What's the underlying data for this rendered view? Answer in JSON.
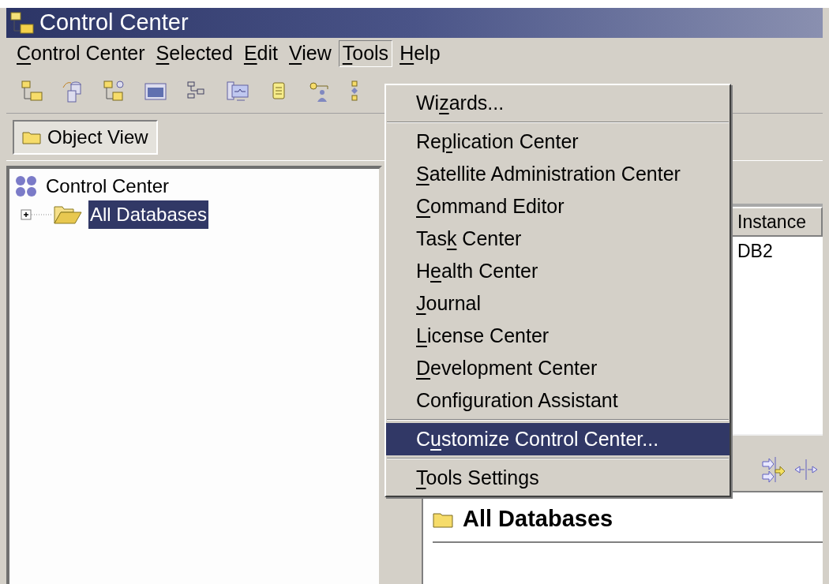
{
  "window": {
    "title": "Control Center"
  },
  "menu_bar": [
    {
      "key": "C",
      "post": "ontrol Center",
      "selected": false
    },
    {
      "key": "S",
      "post": "elected",
      "selected": false
    },
    {
      "key": "E",
      "post": "dit",
      "selected": false
    },
    {
      "key": "V",
      "post": "iew",
      "selected": false
    },
    {
      "key": "T",
      "post": "ools",
      "selected": true
    },
    {
      "key": "H",
      "post": "elp",
      "selected": false
    }
  ],
  "view_tab": {
    "label": "Object View"
  },
  "tree": [
    {
      "label": "Control Center",
      "kind": "root",
      "selected": false,
      "children": [
        {
          "label": "All Databases",
          "kind": "folder",
          "selected": true,
          "expanded": false
        }
      ]
    }
  ],
  "details": {
    "columns": [
      "Instance"
    ],
    "rows": [
      [
        "DB2"
      ]
    ],
    "heading": "All Databases"
  },
  "tools_menu": [
    {
      "kind": "item",
      "pre": "Wi",
      "key": "z",
      "post": "ards...",
      "selected": false
    },
    {
      "kind": "separator"
    },
    {
      "kind": "item",
      "pre": "Re",
      "key": "p",
      "post": "lication Center",
      "selected": false
    },
    {
      "kind": "item",
      "key": "S",
      "post": "atellite Administration Center",
      "selected": false
    },
    {
      "kind": "item",
      "key": "C",
      "post": "ommand Editor",
      "selected": false
    },
    {
      "kind": "item",
      "pre": "Tas",
      "key": "k",
      "post": " Center",
      "selected": false
    },
    {
      "kind": "item",
      "pre": "H",
      "key": "e",
      "post": "alth Center",
      "selected": false
    },
    {
      "kind": "item",
      "key": "J",
      "post": "ournal",
      "selected": false
    },
    {
      "kind": "item",
      "key": "L",
      "post": "icense Center",
      "selected": false
    },
    {
      "kind": "item",
      "key": "D",
      "post": "evelopment Center",
      "selected": false
    },
    {
      "kind": "item",
      "pre": "Configuration Assistant",
      "selected": false
    },
    {
      "kind": "separator"
    },
    {
      "kind": "item",
      "pre": "C",
      "key": "u",
      "post": "stomize Control Center...",
      "selected": true
    },
    {
      "kind": "separator"
    },
    {
      "kind": "item",
      "key": "T",
      "post": "ools Settings",
      "selected": false
    }
  ]
}
